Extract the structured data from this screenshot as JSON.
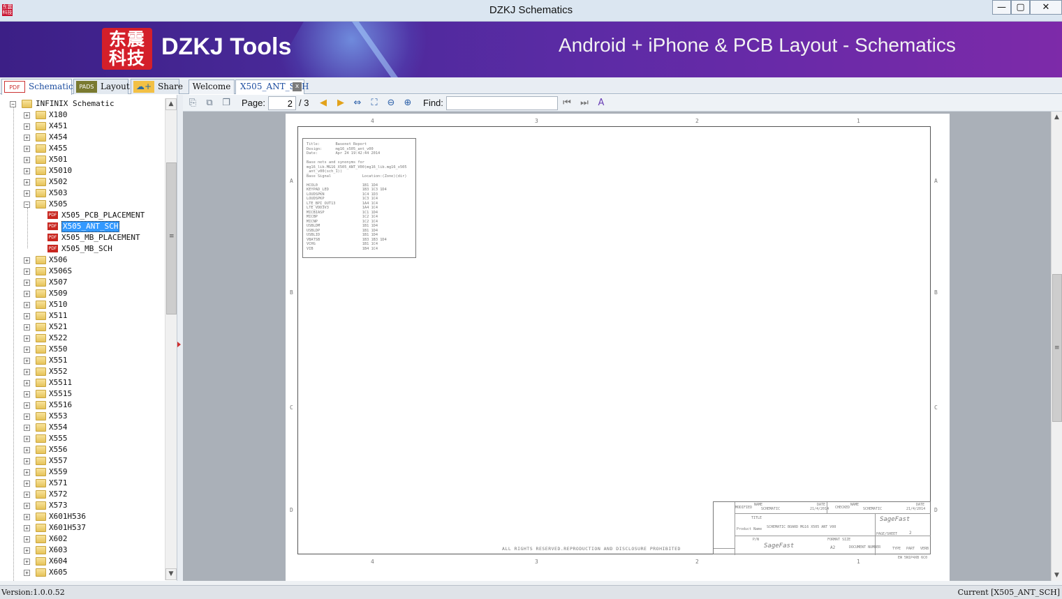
{
  "window": {
    "title": "DZKJ Schematics",
    "app_icon_text": "东震科技",
    "minimize": "—",
    "maximize": "▢",
    "close": "✕"
  },
  "banner": {
    "logo_text": "东震科技",
    "brand": "DZKJ Tools",
    "tagline": "Android + iPhone & PCB Layout - Schematics"
  },
  "left_tabs": [
    {
      "label": "Schematic",
      "icon": "PDF"
    },
    {
      "label": "Layout",
      "icon": "PADS"
    },
    {
      "label": "Share",
      "icon": "☁+"
    }
  ],
  "doc_tabs": [
    {
      "label": "Welcome"
    },
    {
      "label": "X505_ANT_SCH",
      "close": "x"
    }
  ],
  "tree": {
    "root": "INFINIX Schematic",
    "folders": [
      "X180",
      "X451",
      "X454",
      "X455",
      "X501",
      "X5010",
      "X502",
      "X503",
      "X505"
    ],
    "x505_files": [
      "X505_PCB_PLACEMENT",
      "X505_ANT_SCH",
      "X505_MB_PLACEMENT",
      "X505_MB_SCH"
    ],
    "selected": "X505_ANT_SCH",
    "folders_after": [
      "X506",
      "X506S",
      "X507",
      "X509",
      "X510",
      "X511",
      "X521",
      "X522",
      "X550",
      "X551",
      "X552",
      "X5511",
      "X5515",
      "X5516",
      "X553",
      "X554",
      "X555",
      "X556",
      "X557",
      "X559",
      "X571",
      "X572",
      "X573",
      "X601H536",
      "X601H537",
      "X602",
      "X603",
      "X604",
      "X605"
    ],
    "file_icon": "PDF"
  },
  "toolbar": {
    "page_label": "Page:",
    "page_value": "2",
    "page_total": "/ 3",
    "find_label": "Find:",
    "find_value": "",
    "icons": [
      "copy-icon",
      "copy-page-icon",
      "copy-all-icon",
      "prev-page-icon",
      "next-page-icon",
      "fit-width-icon",
      "fit-page-icon",
      "zoom-out-icon",
      "zoom-in-icon",
      "find-prev-icon",
      "find-next-icon",
      "match-case-icon"
    ]
  },
  "schematic": {
    "zones_top": [
      "4",
      "3",
      "2",
      "1"
    ],
    "zones_side": [
      "A",
      "B",
      "C",
      "D"
    ],
    "report_lines": [
      "Title:       Basenet Report",
      "Design:      mg16_x505_ant_v00",
      "Date:        Apr 24 19:42:44 2014",
      "",
      "Base nets and synonyms for",
      "mg16_lib.MG16_X505_ANT_V00(mg16_lib.mg16_x505",
      "_ant_v00(sch_1))",
      "Base Signal              Location:(Zone)(dir)",
      "",
      "HCOL0                    1B1 1D4",
      "KEYPAD_LED               1B3 1C3 1D4",
      "LOUDSPKN                 1C4 1D3",
      "LOUDSPKP                 1C3 1C4",
      "LTE_BPI_OUT13            1A4 1C4",
      "LTE_VDD3V3               1A4 1C4",
      "MICBIASP                 1C1 1D4",
      "MICBP                    1C2 1C4",
      "MICNP                    1C2 1C4",
      "USBLDM                   1B1 1D4",
      "USBLDP                   1B1 1D4",
      "USBLID                   1B1 1D4",
      "VBATSB                   1B3 1B3 1D4",
      "VCHG                     1B1 1C4",
      "VIB                      1B4 1C4"
    ],
    "rights_text": "ALL RIGHTS RESERVED.REPRODUCTION AND DISCLOSURE PROHIBITED",
    "title_block": {
      "modified_label": "MODIFIED",
      "name_label": "NAME",
      "name_value": "SCHEMATIC",
      "date_label": "DATE",
      "date_value": "21/4/2014",
      "checked_label": "CHECKED",
      "checked_name_label": "NAME",
      "checked_name_value": "SCHEMATIC",
      "checked_date_label": "DATE",
      "checked_date_value": "21/4/2014",
      "title_label": "TITLE",
      "product_label": "Product Name",
      "product_value": "SCHEMATIC BOARD MG16 X505 ANT V00",
      "page_sheet_label": "PAGE/SHEET",
      "page_sheet_value": "2",
      "pn_label": "P/N",
      "format_label": "FORMAT SIZE",
      "format_value": "A2",
      "doc_number_label": "DOCUMENT NUMBER",
      "type_label": "TYPE",
      "part_label": "PART",
      "verb_label": "VERB",
      "logo": "SageFast",
      "footer_code": "EW 5N1P4XB 6C0"
    }
  },
  "status": {
    "version": "Version:1.0.0.52",
    "current": "Current [X505_ANT_SCH]"
  }
}
